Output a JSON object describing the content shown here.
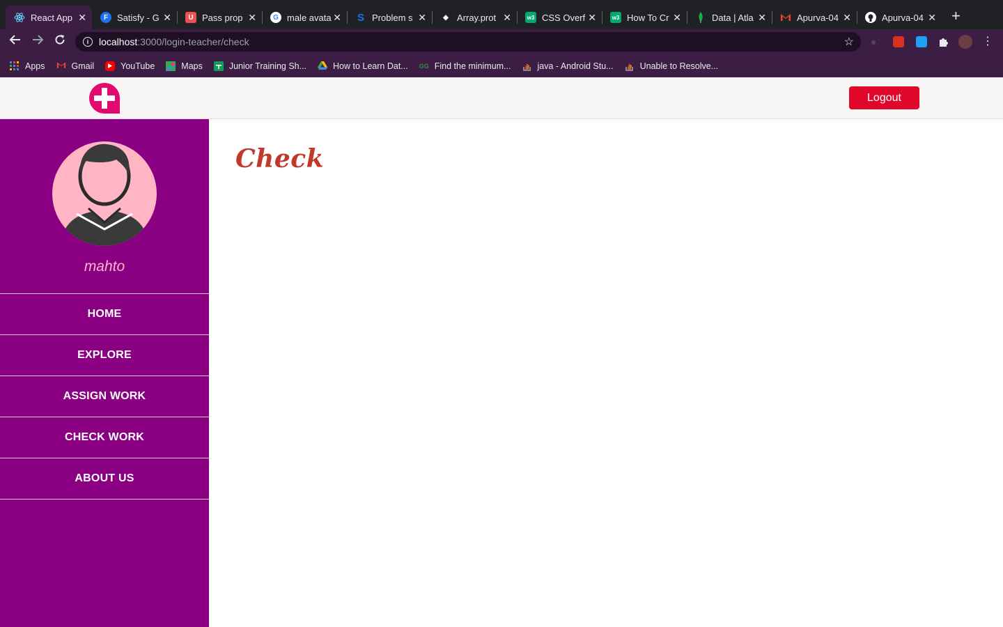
{
  "browser": {
    "tabs": [
      {
        "label": "React App",
        "icon": "react-icon",
        "color": "#61dafb"
      },
      {
        "label": "Satisfy - G",
        "icon": "fonts-icon",
        "color": "#1a73e8"
      },
      {
        "label": "Pass prop",
        "icon": "udemy-icon",
        "color": "#ec5252"
      },
      {
        "label": "male avata",
        "icon": "google-icon",
        "color": "#ffffff"
      },
      {
        "label": "Problem s",
        "icon": "s-icon",
        "color": "#1a73e8"
      },
      {
        "label": "Array.prot",
        "icon": "mdn-icon",
        "color": "#ffffff"
      },
      {
        "label": "CSS Overf",
        "icon": "w3-icon",
        "color": "#04aa6d"
      },
      {
        "label": "How To Cr",
        "icon": "w3-icon",
        "color": "#04aa6d"
      },
      {
        "label": "Data | Atla",
        "icon": "mongodb-leaf-icon",
        "color": "#13aa52"
      },
      {
        "label": "Apurva-04",
        "icon": "gmail-icon",
        "color": "#ea4335"
      },
      {
        "label": "Apurva-04",
        "icon": "github-icon",
        "color": "#ffffff"
      }
    ],
    "new_tab_glyph": "+",
    "close_glyph": "✕",
    "url_host": "localhost",
    "url_path": ":3000/login-teacher/check",
    "bookmarks": [
      {
        "label": "Apps",
        "icon": "apps-grid-icon",
        "color": "#4285f4"
      },
      {
        "label": "Gmail",
        "icon": "gmail-icon",
        "color": "#ea4335"
      },
      {
        "label": "YouTube",
        "icon": "youtube-icon",
        "color": "#ff0000"
      },
      {
        "label": "Maps",
        "icon": "maps-icon",
        "color": "#34a853"
      },
      {
        "label": "Junior Training Sh...",
        "icon": "sheets-icon",
        "color": "#0f9d58"
      },
      {
        "label": "How to Learn Dat...",
        "icon": "drive-icon",
        "color": "#fbbc04"
      },
      {
        "label": "Find the minimum...",
        "icon": "gfg-icon",
        "color": "#2f8d46"
      },
      {
        "label": "java - Android Stu...",
        "icon": "stackoverflow-icon",
        "color": "#f48024"
      },
      {
        "label": "Unable to Resolve...",
        "icon": "stackoverflow-icon",
        "color": "#f48024"
      }
    ]
  },
  "app": {
    "header": {
      "logout_label": "Logout",
      "brand_color": "#e20a6e"
    },
    "sidebar": {
      "username": "mahto",
      "background": "#8b0083",
      "nav": [
        {
          "label": "HOME"
        },
        {
          "label": "EXPLORE"
        },
        {
          "label": "ASSIGN WORK"
        },
        {
          "label": "CHECK WORK"
        },
        {
          "label": "ABOUT US"
        }
      ]
    },
    "main": {
      "title": "Check",
      "title_color": "#c0392b"
    }
  }
}
